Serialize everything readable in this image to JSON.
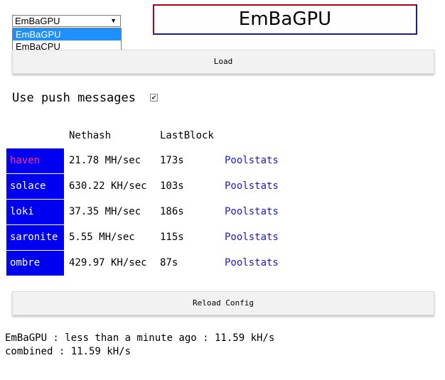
{
  "miner_select": {
    "value": "EmBaGPU",
    "arrow_icon": "triangle-down",
    "options": [
      "EmBaGPU",
      "EmBaCPU"
    ]
  },
  "title": "EmBaGPU",
  "load_button": "Load",
  "push_messages": {
    "label": "Use push messages",
    "checked": true
  },
  "table": {
    "headers": {
      "nethash": "Nethash",
      "lastblock": "LastBlock"
    },
    "rows": [
      {
        "name": "haven",
        "nethash": "21.78 MH/sec",
        "lastblock": "173s",
        "link": "Poolstats"
      },
      {
        "name": "solace",
        "nethash": "630.22 KH/sec",
        "lastblock": "103s",
        "link": "Poolstats"
      },
      {
        "name": "loki",
        "nethash": "37.35 MH/sec",
        "lastblock": "186s",
        "link": "Poolstats"
      },
      {
        "name": "saronite",
        "nethash": "5.55 MH/sec",
        "lastblock": "115s",
        "link": "Poolstats"
      },
      {
        "name": "ombre",
        "nethash": "429.97 KH/sec",
        "lastblock": "87s",
        "link": "Poolstats"
      }
    ]
  },
  "reload_button": "Reload Config",
  "status": {
    "line1": "EmBaGPU : less than a minute ago : 11.59 kH/s",
    "line2": "combined : 11.59 kH/s"
  },
  "colors": {
    "coin_cell_bg": "#0000f0",
    "coin_text": "#ffffff",
    "highlight_coin_text": "#ff2e86",
    "link": "#1a1ac8",
    "dropdown_selected": "#1e90ff"
  }
}
